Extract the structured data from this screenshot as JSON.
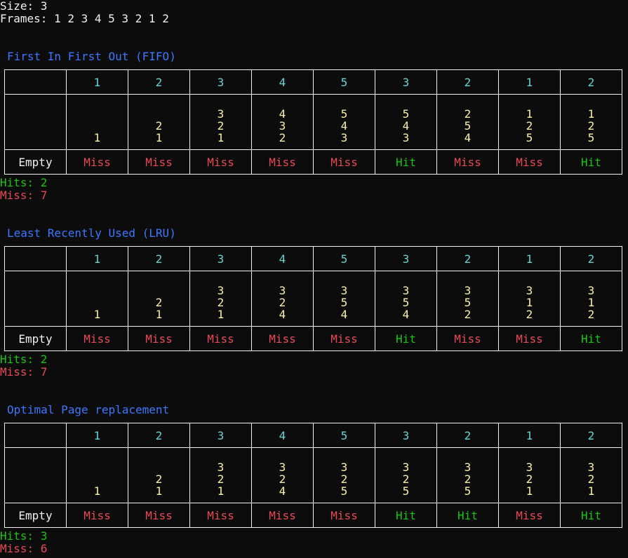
{
  "header": {
    "size_line": "Size: 3",
    "frames_line": "Frames: 1 2 3 4 5 3 2 1 2"
  },
  "colors": {
    "background": "#0c0c0c",
    "text": "#f2f2f2",
    "title": "#3b78ff",
    "reference": "#61d6d6",
    "frame_value": "#f9f1a5",
    "hit": "#16c60c",
    "miss": "#e74856"
  },
  "reference_string": [
    "1",
    "2",
    "3",
    "4",
    "5",
    "3",
    "2",
    "1",
    "2"
  ],
  "sections": [
    {
      "title": "First In First Out (FIFO)",
      "frames": [
        [
          "1"
        ],
        [
          "2",
          "1"
        ],
        [
          "3",
          "2",
          "1"
        ],
        [
          "4",
          "3",
          "2"
        ],
        [
          "5",
          "4",
          "3"
        ],
        [
          "5",
          "4",
          "3"
        ],
        [
          "2",
          "5",
          "4"
        ],
        [
          "1",
          "2",
          "5"
        ],
        [
          "1",
          "2",
          "5"
        ]
      ],
      "status": [
        "Miss",
        "Miss",
        "Miss",
        "Miss",
        "Miss",
        "Hit",
        "Miss",
        "Miss",
        "Hit"
      ],
      "empty_label": "Empty",
      "hits_line": "Hits: 2",
      "miss_line": "Miss: 7"
    },
    {
      "title": "Least Recently Used (LRU)",
      "frames": [
        [
          "1"
        ],
        [
          "2",
          "1"
        ],
        [
          "3",
          "2",
          "1"
        ],
        [
          "3",
          "2",
          "4"
        ],
        [
          "3",
          "5",
          "4"
        ],
        [
          "3",
          "5",
          "4"
        ],
        [
          "3",
          "5",
          "2"
        ],
        [
          "3",
          "1",
          "2"
        ],
        [
          "3",
          "1",
          "2"
        ]
      ],
      "status": [
        "Miss",
        "Miss",
        "Miss",
        "Miss",
        "Miss",
        "Hit",
        "Miss",
        "Miss",
        "Hit"
      ],
      "empty_label": "Empty",
      "hits_line": "Hits: 2",
      "miss_line": "Miss: 7"
    },
    {
      "title": "Optimal Page replacement",
      "frames": [
        [
          "1"
        ],
        [
          "2",
          "1"
        ],
        [
          "3",
          "2",
          "1"
        ],
        [
          "3",
          "2",
          "4"
        ],
        [
          "3",
          "2",
          "5"
        ],
        [
          "3",
          "2",
          "5"
        ],
        [
          "3",
          "2",
          "5"
        ],
        [
          "3",
          "2",
          "1"
        ],
        [
          "3",
          "2",
          "1"
        ]
      ],
      "status": [
        "Miss",
        "Miss",
        "Miss",
        "Miss",
        "Miss",
        "Hit",
        "Hit",
        "Miss",
        "Hit"
      ],
      "empty_label": "Empty",
      "hits_line": "Hits: 3",
      "miss_line": "Miss: 6"
    }
  ]
}
